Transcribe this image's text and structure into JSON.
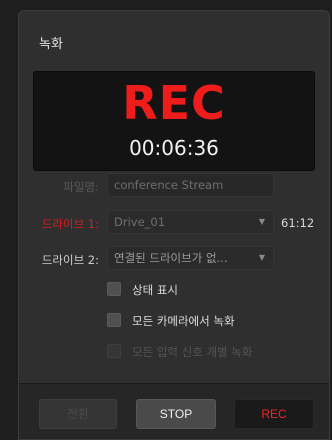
{
  "panel": {
    "title": "녹화"
  },
  "recording": {
    "status_label": "REC",
    "timecode": "00:06:36"
  },
  "filename": {
    "label": "파일명:",
    "value": "conference Stream"
  },
  "drive1": {
    "label": "드라이브 1:",
    "value": "Drive_01",
    "time_remaining": "61:12",
    "caret": "▼",
    "label_color": "#d81e1e"
  },
  "drive2": {
    "label": "드라이브 2:",
    "value": "연결된 드라이브가 없...",
    "caret": "▼"
  },
  "options": [
    {
      "label": "상태 표시",
      "checked": false,
      "enabled": true
    },
    {
      "label": "모든 카메라에서 녹화",
      "checked": false,
      "enabled": true
    },
    {
      "label": "모든 입력 신호 개별 녹화",
      "checked": false,
      "enabled": false
    }
  ],
  "buttons": {
    "switch_label": "전환",
    "stop_label": "STOP",
    "rec_label": "REC"
  },
  "colors": {
    "accent_red": "#ea2828",
    "panel_bg": "#2f2f2f"
  }
}
